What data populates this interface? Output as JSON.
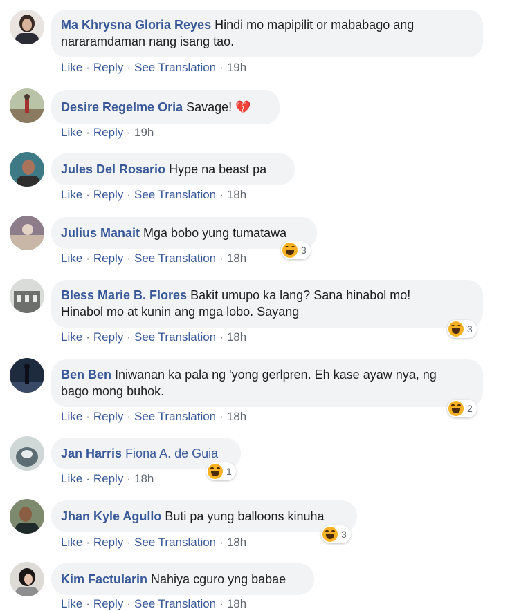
{
  "actions": {
    "like": "Like",
    "reply": "Reply",
    "translate": "See Translation"
  },
  "reaction_color": "#f7b125",
  "comments": [
    {
      "author": "Ma Khrysna Gloria Reyes",
      "text_line1": "Hindi mo mapipilit or mababago ang",
      "text_line2": "nararamdaman nang isang tao.",
      "time": "19h",
      "reactions": ""
    },
    {
      "author": "Desire Regelme Oria",
      "text_line1": "Savage! 💔",
      "text_line2": "",
      "time": "19h",
      "reactions": ""
    },
    {
      "author": "Jules Del Rosario",
      "text_line1": "Hype na beast pa",
      "text_line2": "",
      "time": "18h",
      "reactions": ""
    },
    {
      "author": "Julius Manait",
      "text_line1": "Mga bobo yung tumatawa",
      "text_line2": "",
      "time": "18h",
      "reactions": "3"
    },
    {
      "author": "Bless Marie B. Flores",
      "text_line1": "Bakit umupo ka lang? Sana hinabol mo!",
      "text_line2": "Hinabol mo at kunin ang mga lobo. Sayang",
      "time": "18h",
      "reactions": "3"
    },
    {
      "author": "Ben Ben",
      "text_line1": "Iniwanan ka pala ng 'yong gerlpren. Eh kase ayaw nya, ng",
      "text_line2": "bago mong buhok.",
      "time": "18h",
      "reactions": "2"
    },
    {
      "author": "Jan Harris",
      "text_line1": "Fiona A. de Guia",
      "text_line2": "",
      "time": "18h",
      "reactions": "1"
    },
    {
      "author": "Jhan Kyle Agullo",
      "text_line1": "Buti pa yung balloons kinuha",
      "text_line2": "",
      "time": "18h",
      "reactions": "3"
    },
    {
      "author": "Kim Factularin",
      "text_line1": "Nahiya cguro yng babae",
      "text_line2": "",
      "time": "18h",
      "reactions": ""
    }
  ]
}
